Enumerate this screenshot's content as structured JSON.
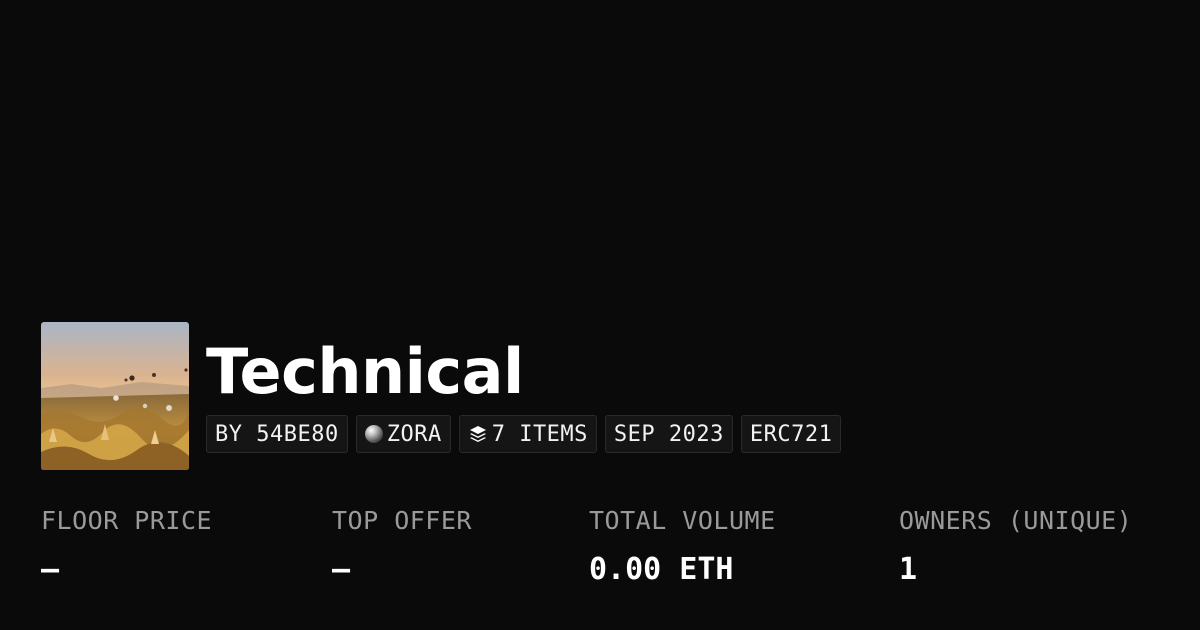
{
  "collection": {
    "title": "Technical",
    "thumbnail_icon": "hot-air-balloons-landscape-image"
  },
  "tags": {
    "creator": "BY 54BE80",
    "chain": "ZORA",
    "chain_icon": "sphere-icon",
    "items": "7 ITEMS",
    "items_icon": "layers-icon",
    "date": "SEP 2023",
    "standard": "ERC721"
  },
  "stats": [
    {
      "label": "FLOOR PRICE",
      "value": "–"
    },
    {
      "label": "TOP OFFER",
      "value": "–"
    },
    {
      "label": "TOTAL VOLUME",
      "value": "0.00 ETH"
    },
    {
      "label": "OWNERS (UNIQUE)",
      "value": "1"
    }
  ],
  "colors": {
    "background": "#0a0a0a",
    "text": "#ffffff",
    "muted": "#9a9a9a"
  }
}
